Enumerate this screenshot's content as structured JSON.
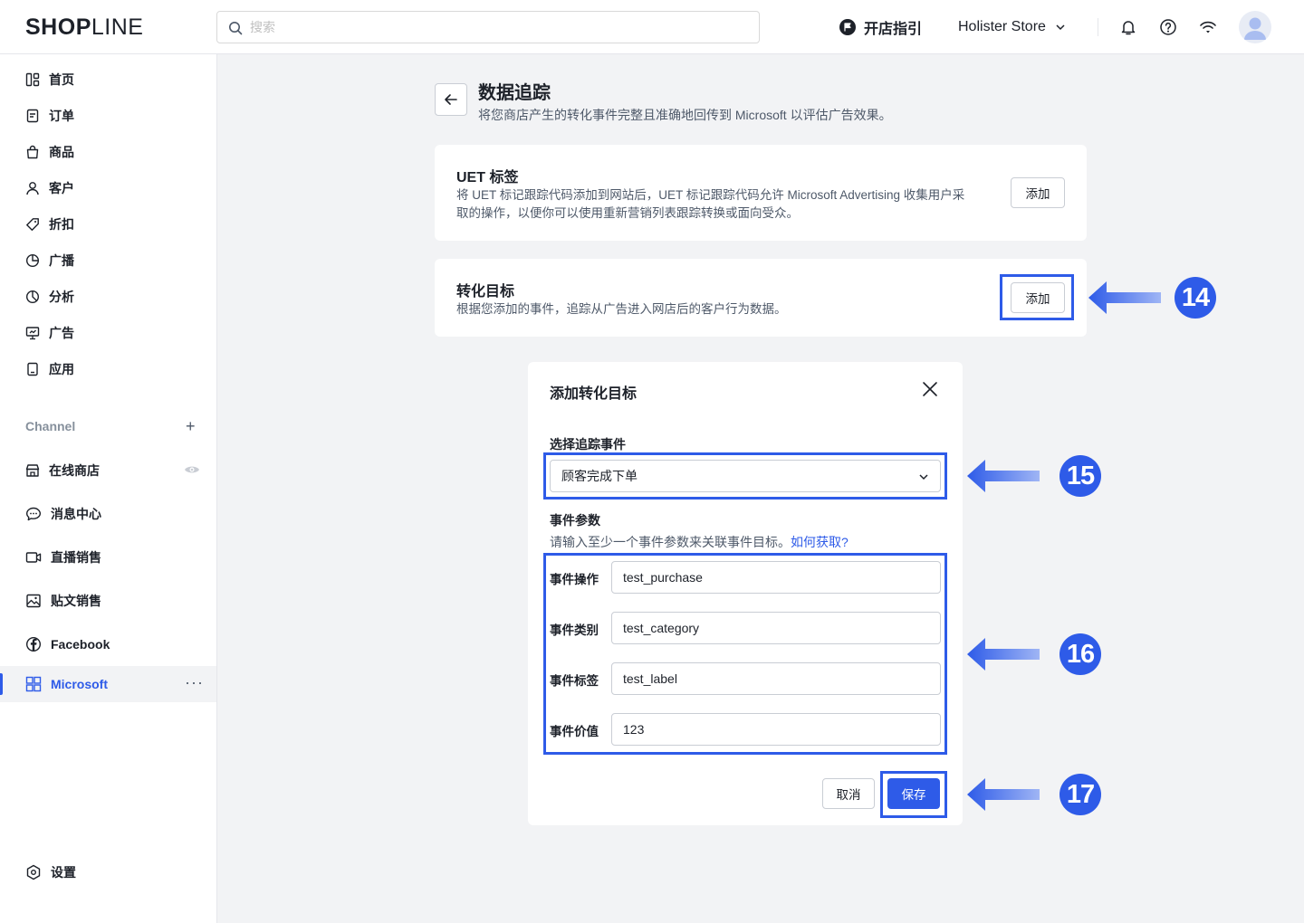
{
  "brand": {
    "logo_bold": "SH",
    "logo_o": "O",
    "logo_p": "P",
    "logo_thin": "LINE",
    "accent": "#2e5be8"
  },
  "topbar": {
    "search_placeholder": "搜索",
    "guide_label": "开店指引",
    "store_name": "Holister Store"
  },
  "sidebar": {
    "main_items": [
      {
        "label": "首页",
        "icon": "dashboard-icon"
      },
      {
        "label": "订单",
        "icon": "order-icon"
      },
      {
        "label": "商品",
        "icon": "bag-icon"
      },
      {
        "label": "客户",
        "icon": "user-icon"
      },
      {
        "label": "折扣",
        "icon": "tag-icon"
      },
      {
        "label": "广播",
        "icon": "broadcast-icon"
      },
      {
        "label": "分析",
        "icon": "pie-chart-icon"
      },
      {
        "label": "广告",
        "icon": "ad-icon"
      },
      {
        "label": "应用",
        "icon": "app-icon"
      }
    ],
    "channel_title": "Channel",
    "channel_items": [
      {
        "label": "在线商店",
        "icon": "store-icon"
      },
      {
        "label": "消息中心",
        "icon": "chat-icon"
      },
      {
        "label": "直播销售",
        "icon": "video-icon"
      },
      {
        "label": "贴文销售",
        "icon": "image-icon"
      },
      {
        "label": "Facebook",
        "icon": "facebook-icon"
      },
      {
        "label": "Microsoft",
        "icon": "microsoft-icon"
      }
    ],
    "settings_label": "设置"
  },
  "page": {
    "title": "数据追踪",
    "subtitle": "将您商店产生的转化事件完整且准确地回传到 Microsoft 以评估广告效果。"
  },
  "uet_card": {
    "title": "UET 标签",
    "text_line1": "将 UET 标记跟踪代码添加到网站后，UET 标记跟踪代码允许 Microsoft Advertising 收集用户采",
    "text_line2": "取的操作，以便你可以使用重新营销列表跟踪转换或面向受众。",
    "button": "添加"
  },
  "goal_card": {
    "title": "转化目标",
    "text": "根据您添加的事件，追踪从广告进入网店后的客户行为数据。",
    "button": "添加"
  },
  "modal": {
    "title": "添加转化目标",
    "event_label": "选择追踪事件",
    "event_value": "顾客完成下单",
    "params_label": "事件参数",
    "params_hint": "请输入至少一个事件参数来关联事件目标。",
    "params_link": "如何获取?",
    "params": [
      {
        "label": "事件操作",
        "value": "test_purchase"
      },
      {
        "label": "事件类别",
        "value": "test_category"
      },
      {
        "label": "事件标签",
        "value": "test_label"
      },
      {
        "label": "事件价值",
        "value": "123"
      }
    ],
    "cancel": "取消",
    "save": "保存"
  },
  "annotations": [
    "14",
    "15",
    "16",
    "17"
  ]
}
